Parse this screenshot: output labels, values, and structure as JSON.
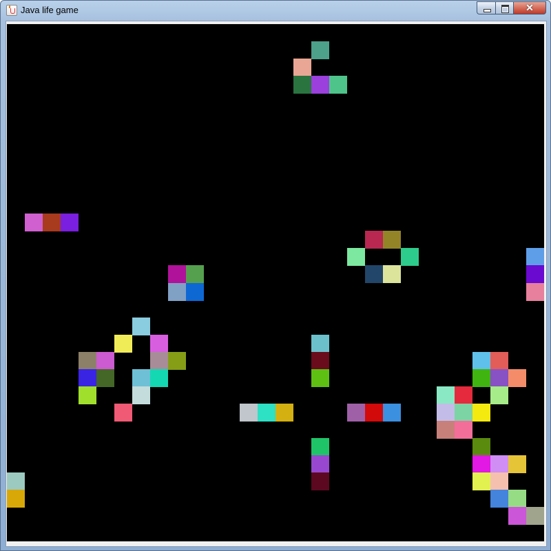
{
  "window": {
    "title": "Java life game",
    "close_symbol": "✕"
  },
  "board": {
    "background": "#000000",
    "columns": 30,
    "rows": 30,
    "live_cells": [
      {
        "col": 17,
        "row": 1,
        "color": "#4da08a"
      },
      {
        "col": 16,
        "row": 2,
        "color": "#eaa694"
      },
      {
        "col": 16,
        "row": 3,
        "color": "#2a7440"
      },
      {
        "col": 17,
        "row": 3,
        "color": "#9b3fdd"
      },
      {
        "col": 18,
        "row": 3,
        "color": "#4ec48a"
      },
      {
        "col": 1,
        "row": 11,
        "color": "#d060d0"
      },
      {
        "col": 2,
        "row": 11,
        "color": "#a83a1e"
      },
      {
        "col": 3,
        "row": 11,
        "color": "#7a1ee0"
      },
      {
        "col": 20,
        "row": 12,
        "color": "#b82850"
      },
      {
        "col": 21,
        "row": 12,
        "color": "#948428"
      },
      {
        "col": 19,
        "row": 13,
        "color": "#7ce8a0"
      },
      {
        "col": 22,
        "row": 13,
        "color": "#2ecc8c"
      },
      {
        "col": 29,
        "row": 13,
        "color": "#5e9ee8"
      },
      {
        "col": 9,
        "row": 14,
        "color": "#b0129a"
      },
      {
        "col": 10,
        "row": 14,
        "color": "#54a04e"
      },
      {
        "col": 20,
        "row": 14,
        "color": "#22466a"
      },
      {
        "col": 21,
        "row": 14,
        "color": "#dce49c"
      },
      {
        "col": 29,
        "row": 14,
        "color": "#6a0ad0"
      },
      {
        "col": 9,
        "row": 15,
        "color": "#80a0c4"
      },
      {
        "col": 10,
        "row": 15,
        "color": "#0e68d4"
      },
      {
        "col": 29,
        "row": 15,
        "color": "#e6809c"
      },
      {
        "col": 7,
        "row": 17,
        "color": "#8acce0"
      },
      {
        "col": 6,
        "row": 18,
        "color": "#f0ec58"
      },
      {
        "col": 8,
        "row": 18,
        "color": "#d85ee0"
      },
      {
        "col": 17,
        "row": 18,
        "color": "#6cc0cc"
      },
      {
        "col": 4,
        "row": 19,
        "color": "#8c8068"
      },
      {
        "col": 5,
        "row": 19,
        "color": "#cc5ad0"
      },
      {
        "col": 8,
        "row": 19,
        "color": "#a88c98"
      },
      {
        "col": 9,
        "row": 19,
        "color": "#869e16"
      },
      {
        "col": 17,
        "row": 19,
        "color": "#6a0c1c"
      },
      {
        "col": 26,
        "row": 19,
        "color": "#60c0ec"
      },
      {
        "col": 27,
        "row": 19,
        "color": "#e25c58"
      },
      {
        "col": 4,
        "row": 20,
        "color": "#3a24e4"
      },
      {
        "col": 5,
        "row": 20,
        "color": "#446626"
      },
      {
        "col": 7,
        "row": 20,
        "color": "#6ec0d6"
      },
      {
        "col": 8,
        "row": 20,
        "color": "#14d8b2"
      },
      {
        "col": 17,
        "row": 20,
        "color": "#5ec012"
      },
      {
        "col": 26,
        "row": 20,
        "color": "#40b410"
      },
      {
        "col": 27,
        "row": 20,
        "color": "#8852c4"
      },
      {
        "col": 28,
        "row": 20,
        "color": "#f48c6a"
      },
      {
        "col": 4,
        "row": 21,
        "color": "#a0e02c"
      },
      {
        "col": 7,
        "row": 21,
        "color": "#c4dcdc"
      },
      {
        "col": 24,
        "row": 21,
        "color": "#8ae8c4"
      },
      {
        "col": 25,
        "row": 21,
        "color": "#e42a3c"
      },
      {
        "col": 27,
        "row": 21,
        "color": "#a6ec88"
      },
      {
        "col": 6,
        "row": 22,
        "color": "#f05a74"
      },
      {
        "col": 13,
        "row": 22,
        "color": "#c0c6cc"
      },
      {
        "col": 14,
        "row": 22,
        "color": "#2ee0c4"
      },
      {
        "col": 15,
        "row": 22,
        "color": "#d4b010"
      },
      {
        "col": 19,
        "row": 22,
        "color": "#a060a8"
      },
      {
        "col": 20,
        "row": 22,
        "color": "#d20a0a"
      },
      {
        "col": 21,
        "row": 22,
        "color": "#3c90e0"
      },
      {
        "col": 24,
        "row": 22,
        "color": "#c4bce8"
      },
      {
        "col": 25,
        "row": 22,
        "color": "#7cd4a4"
      },
      {
        "col": 26,
        "row": 22,
        "color": "#f4ea10"
      },
      {
        "col": 24,
        "row": 23,
        "color": "#c8807a"
      },
      {
        "col": 25,
        "row": 23,
        "color": "#f46e9a"
      },
      {
        "col": 17,
        "row": 24,
        "color": "#20c468"
      },
      {
        "col": 26,
        "row": 24,
        "color": "#5a8a0e"
      },
      {
        "col": 17,
        "row": 25,
        "color": "#9848d0"
      },
      {
        "col": 26,
        "row": 25,
        "color": "#e218e4"
      },
      {
        "col": 27,
        "row": 25,
        "color": "#d08ef4"
      },
      {
        "col": 28,
        "row": 25,
        "color": "#e6c438"
      },
      {
        "col": 0,
        "row": 26,
        "color": "#9ccac0"
      },
      {
        "col": 17,
        "row": 26,
        "color": "#5c0820"
      },
      {
        "col": 26,
        "row": 26,
        "color": "#e2f050"
      },
      {
        "col": 27,
        "row": 26,
        "color": "#f6c0ae"
      },
      {
        "col": 0,
        "row": 27,
        "color": "#d8a808"
      },
      {
        "col": 27,
        "row": 27,
        "color": "#4484dc"
      },
      {
        "col": 28,
        "row": 27,
        "color": "#96dc84"
      },
      {
        "col": 28,
        "row": 28,
        "color": "#cc56d8"
      },
      {
        "col": 29,
        "row": 28,
        "color": "#a0a48c"
      }
    ]
  }
}
